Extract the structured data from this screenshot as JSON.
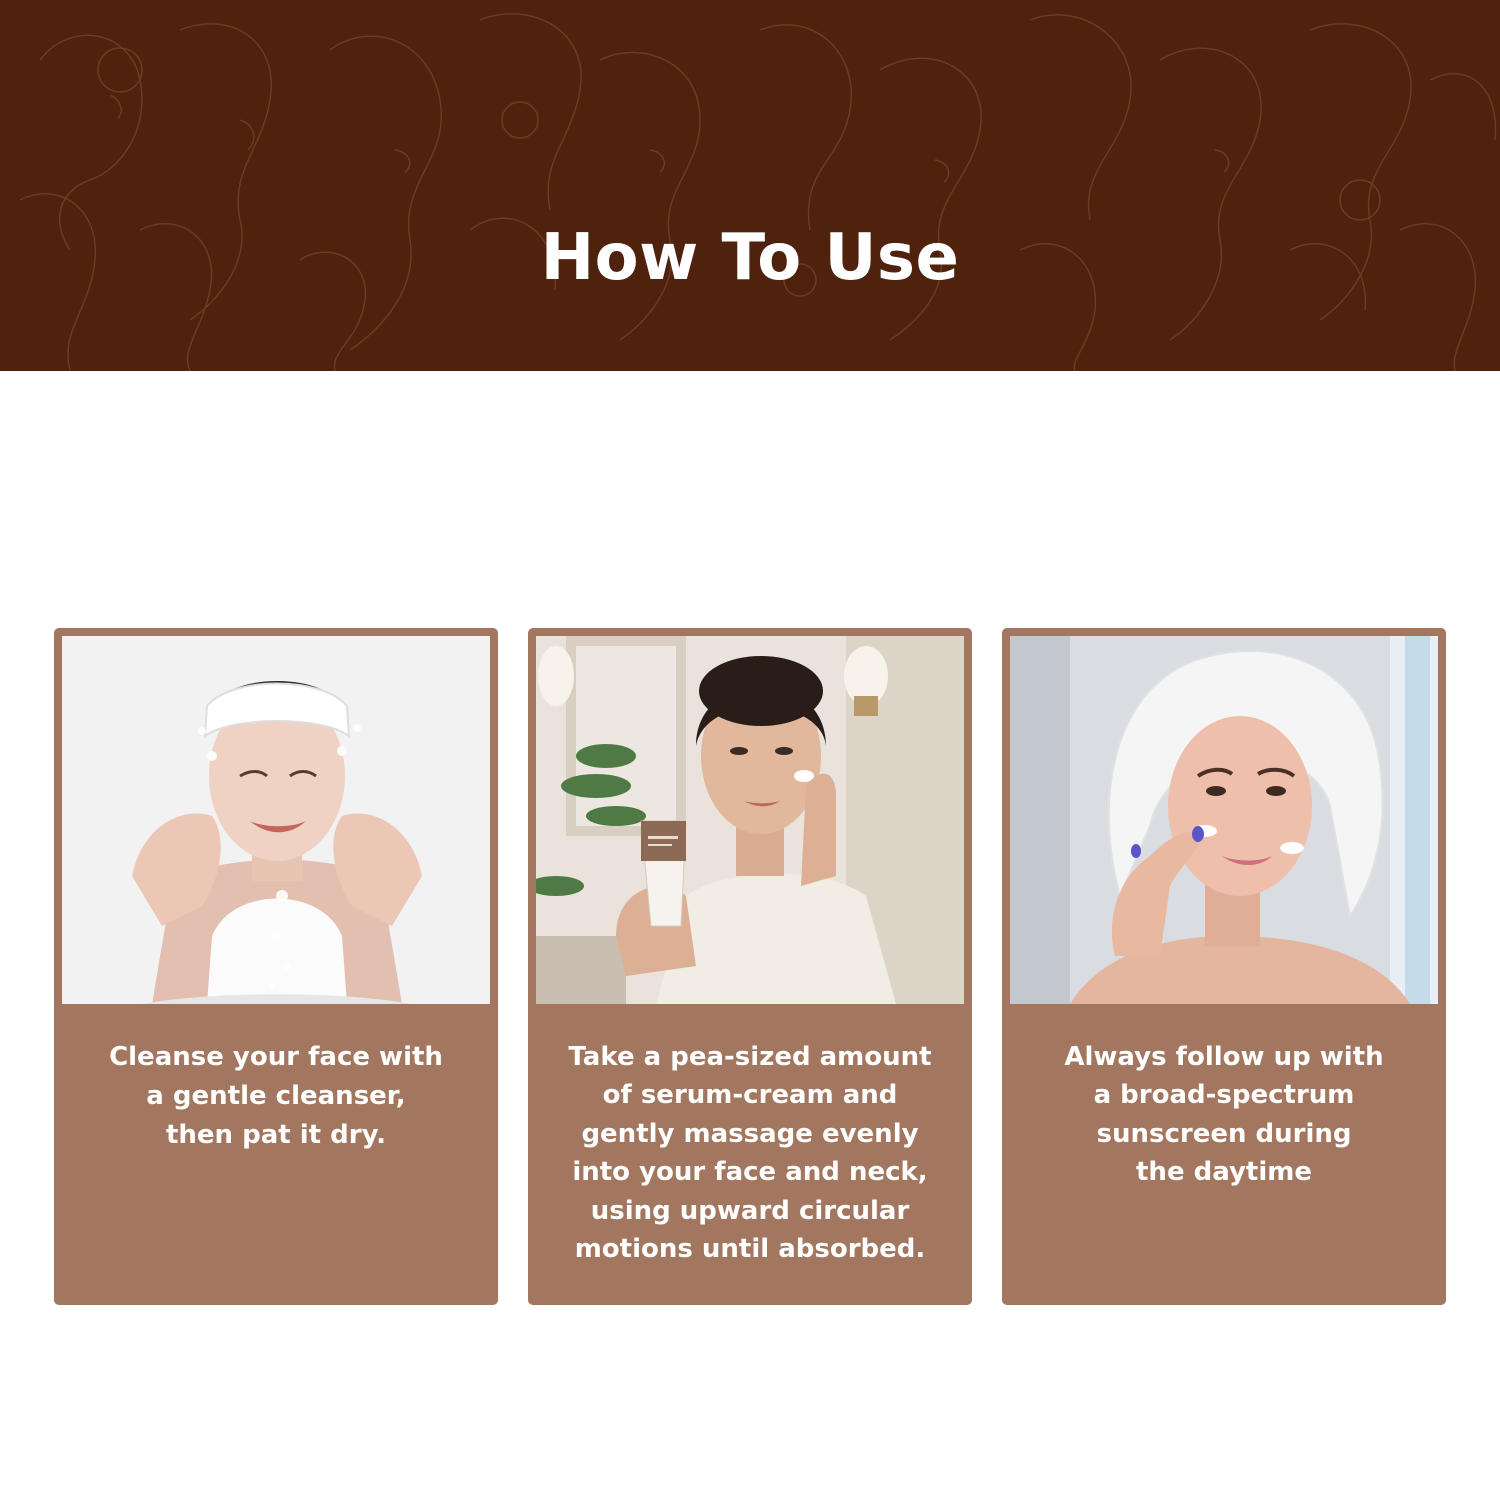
{
  "header": {
    "title": "How To Use"
  },
  "steps": [
    {
      "lines": [
        "Cleanse your face with",
        "a gentle cleanser,",
        "then pat it dry."
      ]
    },
    {
      "lines": [
        "Take a pea-sized amount",
        "of serum-cream and",
        "gently massage evenly",
        "into your face and neck,",
        "using upward circular",
        "motions until absorbed."
      ]
    },
    {
      "lines": [
        "Always follow up with",
        "a broad-spectrum",
        "sunscreen during",
        "the daytime"
      ]
    }
  ],
  "colors": {
    "header_bg": "#4f220d",
    "card_bg": "#a3775f",
    "text": "#ffffff"
  }
}
